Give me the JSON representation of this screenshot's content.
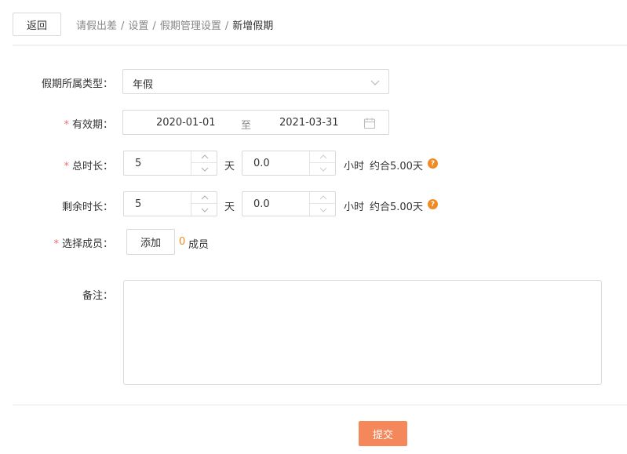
{
  "header": {
    "back_label": "返回",
    "breadcrumb": [
      "请假出差",
      "设置",
      "假期管理设置",
      "新增假期"
    ],
    "separator": "/"
  },
  "form": {
    "leave_type": {
      "label": "假期所属类型：",
      "value": "年假"
    },
    "validity": {
      "required_mark": "*",
      "label": "有效期：",
      "start": "2020-01-01",
      "to_text": "至",
      "end": "2021-03-31"
    },
    "total_duration": {
      "required_mark": "*",
      "label": "总时长：",
      "days": "5",
      "days_unit": "天",
      "hours": "0.0",
      "hours_unit": "小时",
      "approx": "约合5.00天"
    },
    "remaining_duration": {
      "label": "剩余时长：",
      "days": "5",
      "days_unit": "天",
      "hours": "0.0",
      "hours_unit": "小时",
      "approx": "约合5.00天"
    },
    "members": {
      "required_mark": "*",
      "label": "选择成员：",
      "add_label": "添加",
      "count": "0",
      "unit": "成员"
    },
    "remark": {
      "label": "备注：",
      "value": ""
    }
  },
  "footer": {
    "submit_label": "提交"
  },
  "colors": {
    "accent": "#f08a24",
    "submit_bg": "#f5885a",
    "required": "#f56c6c",
    "border": "#d9d9d9"
  },
  "icons": {
    "help": "question-icon",
    "calendar": "calendar-icon",
    "dropdown": "chevron-down-icon"
  }
}
